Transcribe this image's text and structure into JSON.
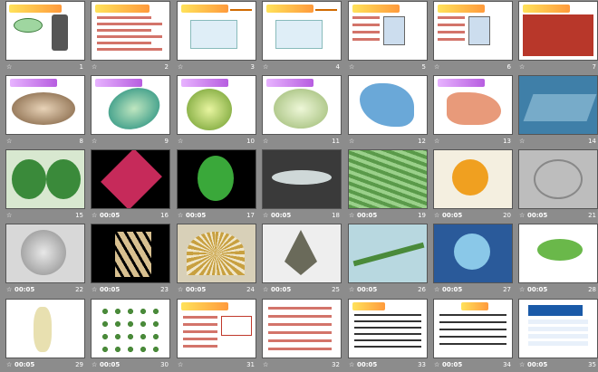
{
  "slides": [
    {
      "n": "1",
      "time": ""
    },
    {
      "n": "2",
      "time": ""
    },
    {
      "n": "3",
      "time": ""
    },
    {
      "n": "4",
      "time": ""
    },
    {
      "n": "5",
      "time": ""
    },
    {
      "n": "6",
      "time": ""
    },
    {
      "n": "7",
      "time": ""
    },
    {
      "n": "8",
      "time": ""
    },
    {
      "n": "9",
      "time": ""
    },
    {
      "n": "10",
      "time": ""
    },
    {
      "n": "11",
      "time": ""
    },
    {
      "n": "12",
      "time": ""
    },
    {
      "n": "13",
      "time": ""
    },
    {
      "n": "14",
      "time": ""
    },
    {
      "n": "15",
      "time": ""
    },
    {
      "n": "16",
      "time": "00:05"
    },
    {
      "n": "17",
      "time": "00:05"
    },
    {
      "n": "18",
      "time": "00:05"
    },
    {
      "n": "19",
      "time": "00:05"
    },
    {
      "n": "20",
      "time": "00:05"
    },
    {
      "n": "21",
      "time": "00:05"
    },
    {
      "n": "22",
      "time": "00:05"
    },
    {
      "n": "23",
      "time": "00:05"
    },
    {
      "n": "24",
      "time": "00:05"
    },
    {
      "n": "25",
      "time": "00:05"
    },
    {
      "n": "26",
      "time": "00:05"
    },
    {
      "n": "27",
      "time": "00:05"
    },
    {
      "n": "28",
      "time": "00:05"
    },
    {
      "n": "29",
      "time": "00:05"
    },
    {
      "n": "30",
      "time": "00:05"
    },
    {
      "n": "31",
      "time": ""
    },
    {
      "n": "32",
      "time": ""
    },
    {
      "n": "33",
      "time": "00:05"
    },
    {
      "n": "34",
      "time": "00:05"
    },
    {
      "n": "35",
      "time": "00:05"
    }
  ],
  "star_glyph": "☆",
  "colors": {
    "background": "#8c8c8c",
    "caption_text": "#ffffff",
    "title_accent": "#ff9a3c"
  }
}
